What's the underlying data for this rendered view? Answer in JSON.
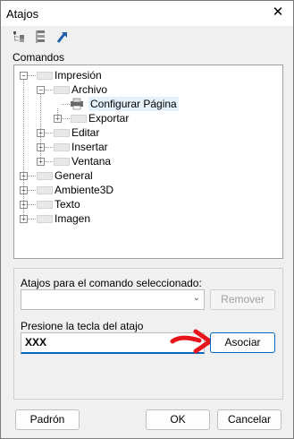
{
  "window": {
    "title": "Atajos",
    "close_glyph": "✕"
  },
  "toolbar": {
    "buttons": [
      "expand-tree-icon",
      "collapse-tree-icon",
      "go-to-icon"
    ]
  },
  "commands_label": "Comandos",
  "tree": {
    "nodes": [
      {
        "label": "Impresión",
        "level": 0,
        "expanded": true
      },
      {
        "label": "Archivo",
        "level": 1,
        "expanded": true
      },
      {
        "label": "Configurar Página",
        "level": 2,
        "selected": true,
        "leaf": true
      },
      {
        "label": "Exportar",
        "level": 2,
        "expanded": false
      },
      {
        "label": "Editar",
        "level": 1,
        "expanded": false
      },
      {
        "label": "Insertar",
        "level": 1,
        "expanded": false
      },
      {
        "label": "Ventana",
        "level": 1,
        "expanded": false
      },
      {
        "label": "General",
        "level": 0,
        "expanded": false
      },
      {
        "label": "Ambiente3D",
        "level": 0,
        "expanded": false
      },
      {
        "label": "Texto",
        "level": 0,
        "expanded": false
      },
      {
        "label": "Imagen",
        "level": 0,
        "expanded": false
      }
    ]
  },
  "shortcuts": {
    "label": "Atajos para el comando seleccionado:",
    "combo_value": "",
    "remove_button": "Remover"
  },
  "press_key": {
    "label": "Presione la tecla del atajo",
    "value": "XXX",
    "assign_button": "Asociar"
  },
  "footer": {
    "default_button": "Padrón",
    "ok_button": "OK",
    "cancel_button": "Cancelar"
  },
  "colors": {
    "accent": "#0067c0",
    "arrow": "#e8141b"
  }
}
